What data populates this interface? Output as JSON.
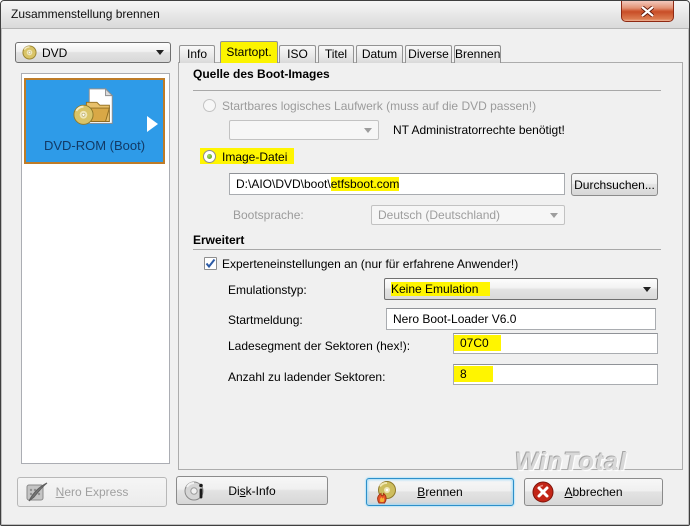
{
  "window": {
    "title": "Zusammenstellung brennen"
  },
  "sidebar": {
    "media_select": {
      "value": "DVD"
    },
    "items": [
      {
        "label": "DVD-ROM (Boot)",
        "selected": true
      }
    ]
  },
  "tabs": [
    {
      "label": "Info"
    },
    {
      "label": "Startopt.",
      "active": true,
      "highlighted": true
    },
    {
      "label": "ISO"
    },
    {
      "label": "Titel"
    },
    {
      "label": "Datum"
    },
    {
      "label": "Diverse"
    },
    {
      "label": "Brennen"
    }
  ],
  "boot_source": {
    "title": "Quelle des Boot-Images",
    "drive_radio_label": "Startbares logisches Laufwerk (muss auf die DVD passen!)",
    "drive_radio_enabled": false,
    "drive_select_value": "",
    "admin_note": "NT Administratorrechte benötigt!",
    "image_radio_label": "Image-Datei",
    "image_radio_selected": true,
    "image_path": {
      "prefix": "D:\\AIO\\DVD\\boot\\",
      "highlight": "etfsboot.com"
    },
    "browse_label": "Durchsuchen...",
    "bootlang_label": "Bootsprache:",
    "bootlang_value": "Deutsch (Deutschland)"
  },
  "advanced": {
    "title": "Erweitert",
    "expert_label": "Experteneinstellungen an (nur für erfahrene Anwender!)",
    "expert_checked": true,
    "emulation_label": "Emulationstyp:",
    "emulation_value": "Keine Emulation",
    "boot_message_label": "Startmeldung:",
    "boot_message_value": "Nero Boot-Loader V6.0",
    "load_segment_label": "Ladesegment der Sektoren (hex!):",
    "load_segment_value": "07C0",
    "sector_count_label": "Anzahl zu ladender Sektoren:",
    "sector_count_value": "8"
  },
  "footer": {
    "nero_express": {
      "key": "N",
      "post": "ero Express",
      "enabled": false
    },
    "disk_info": {
      "pre": "Di",
      "key": "s",
      "post": "k-Info"
    },
    "brennen": {
      "key": "B",
      "post": "rennen",
      "default": true
    },
    "abbrechen": {
      "key": "A",
      "post": "bbrechen"
    },
    "watermark": "WinTotal"
  },
  "colors": {
    "selection_blue": "#2E9BE8",
    "selection_border_orange": "#BE7C28",
    "highlight_yellow": "#FFF500",
    "focus_ring_blue": "#2D8FC9",
    "cancel_red": "#C22517",
    "close_button_red": "#CE5730"
  }
}
